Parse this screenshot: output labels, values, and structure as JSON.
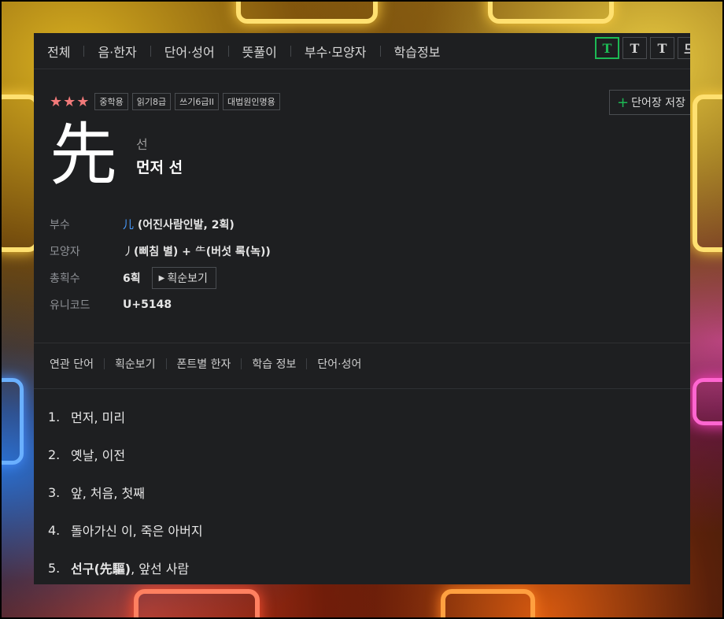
{
  "nav": {
    "items": [
      "전체",
      "음·한자",
      "단어·성어",
      "뜻풀이",
      "부수·모양자",
      "학습정보"
    ],
    "font_buttons": [
      "T",
      "T",
      "T",
      "므"
    ]
  },
  "entry": {
    "rating_stars": "★★★",
    "badges": [
      "중학용",
      "읽기8급",
      "쓰기6급II",
      "대법원인명용"
    ],
    "save_label": "단어장 저장",
    "hanja": "先",
    "reading": "선",
    "meaning": "먼저 선"
  },
  "info": {
    "radical_label": "부수",
    "radical_char": "儿",
    "radical_desc": " (어진사람인발, 2획)",
    "shape_label": "모양자",
    "shape_char1": "丿",
    "shape_desc1": "(삐침 별) + ",
    "shape_char2": "⺧",
    "shape_desc2": "(버섯 록(녹))",
    "strokes_label": "총획수",
    "strokes_value": "6획",
    "stroke_button": "획순보기",
    "unicode_label": "유니코드",
    "unicode_value": "U+5148"
  },
  "subnav": [
    "연관 단어",
    "획순보기",
    "폰트별 한자",
    "학습 정보",
    "단어·성어"
  ],
  "definitions": [
    {
      "num": "1.",
      "text": "먼저, 미리"
    },
    {
      "num": "2.",
      "text": "옛날, 이전"
    },
    {
      "num": "3.",
      "text": "앞, 처음, 첫째"
    },
    {
      "num": "4.",
      "text": "돌아가신 이, 죽은 아버지"
    },
    {
      "num": "5.",
      "text_bold": "선구(先驅)",
      "text": ", 앞선 사람"
    }
  ],
  "colors": {
    "panel_bg": "#1e1f21",
    "accent_green": "#1db954",
    "star_red": "#f27a7a",
    "link_blue": "#4a9cff"
  }
}
